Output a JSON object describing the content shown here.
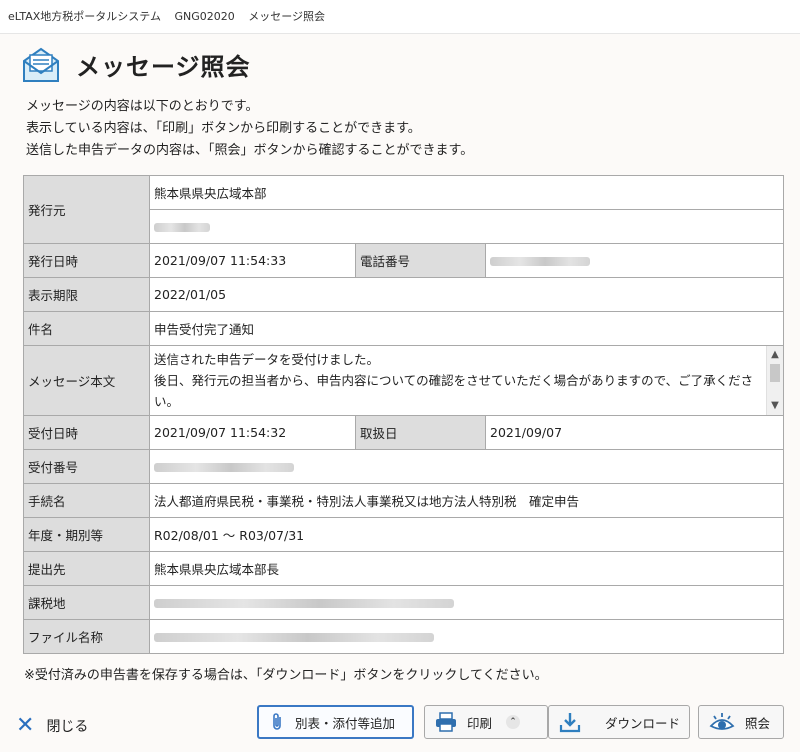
{
  "window": {
    "app": "eLTAX地方税ポータルシステム",
    "code": "GNG02020",
    "screen": "メッセージ照会"
  },
  "header": {
    "title": "メッセージ照会"
  },
  "intro": [
    "メッセージの内容は以下のとおりです。",
    "表示している内容は、「印刷」ボタンから印刷することができます。",
    "送信した申告データの内容は、「照会」ボタンから確認することができます。"
  ],
  "fields": {
    "issuer_label": "発行元",
    "issuer_value": "熊本県県央広域本部",
    "issued_at_label": "発行日時",
    "issued_at_value": "2021/09/07 11:54:33",
    "phone_label": "電話番号",
    "display_until_label": "表示期限",
    "display_until_value": "2022/01/05",
    "subject_label": "件名",
    "subject_value": "申告受付完了通知",
    "body_label": "メッセージ本文",
    "body_value": "送信された申告データを受付けました。\n後日、発行元の担当者から、申告内容についての確認をさせていただく場合がありますので、ご了承ください。",
    "received_at_label": "受付日時",
    "received_at_value": "2021/09/07 11:54:32",
    "handling_date_label": "取扱日",
    "handling_date_value": "2021/09/07",
    "receipt_no_label": "受付番号",
    "procedure_label": "手続名",
    "procedure_value": "法人都道府県民税・事業税・特別法人事業税又は地方法人特別税　確定申告",
    "period_label": "年度・期別等",
    "period_value": "R02/08/01 ～ R03/07/31",
    "submit_to_label": "提出先",
    "submit_to_value": "熊本県県央広域本部長",
    "tax_location_label": "課税地",
    "file_name_label": "ファイル名称"
  },
  "note": "※受付済みの申告書を保存する場合は、「ダウンロード」ボタンをクリックしてください。",
  "footer": {
    "close": "閉じる",
    "attach": "別表・添付等追加",
    "print": "印刷",
    "download": "ダウンロード",
    "inquiry": "照会"
  },
  "colors": {
    "accent": "#3a78c4",
    "label_bg": "#dddddd",
    "border": "#a9a9a9"
  },
  "icons": [
    "envelope-icon",
    "close-icon",
    "paperclip-icon",
    "printer-icon",
    "download-icon",
    "inquiry-icon"
  ]
}
